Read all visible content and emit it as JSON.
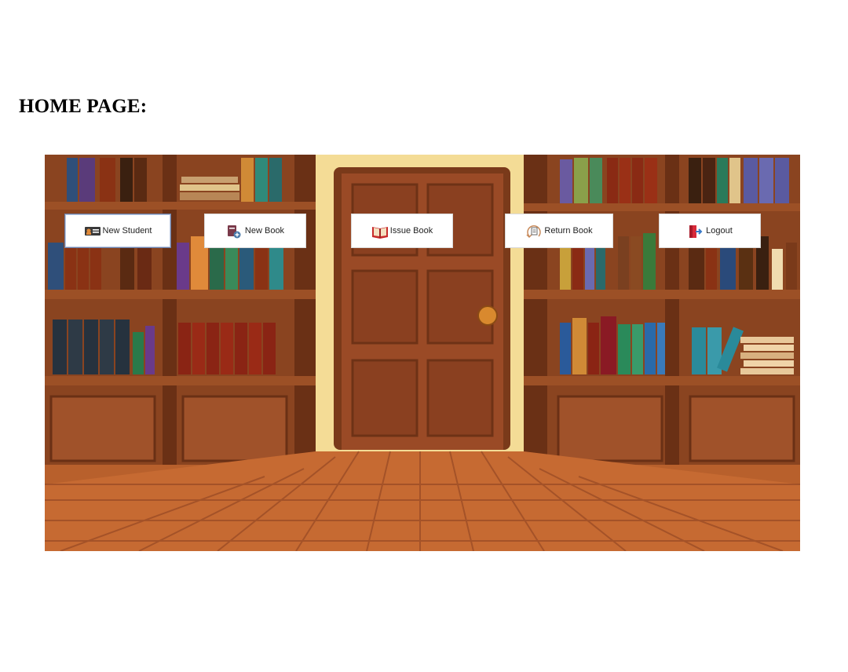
{
  "heading": "HOME PAGE:",
  "toolbar": {
    "buttons": [
      {
        "label": "New Student",
        "icon": "student-id-card-icon",
        "active": true
      },
      {
        "label": "New Book",
        "icon": "add-book-icon",
        "active": false
      },
      {
        "label": "Issue Book",
        "icon": "open-book-icon",
        "active": false
      },
      {
        "label": "Return Book",
        "icon": "return-document-icon",
        "active": false
      },
      {
        "label": "Logout",
        "icon": "logout-door-icon",
        "active": false
      }
    ]
  },
  "colors": {
    "wall": "#f4dc96",
    "wood_dark": "#7a3a1a",
    "wood_mid": "#a4522a",
    "door": "#9a4a26",
    "floor_light": "#d07a40",
    "floor_dark": "#a85128"
  }
}
